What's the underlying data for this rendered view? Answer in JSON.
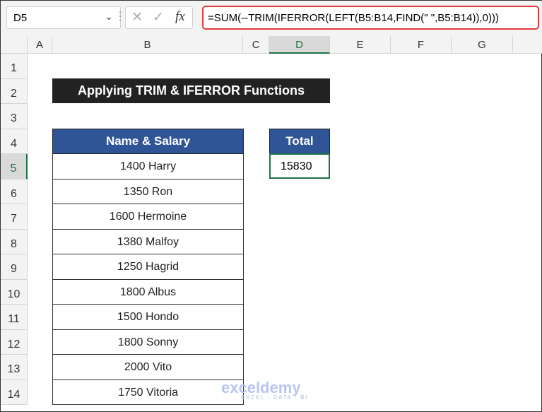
{
  "name_box": "D5",
  "formula": "=SUM(--TRIM(IFERROR(LEFT(B5:B14,FIND(\" \",B5:B14)),0)))",
  "formula_icons": [
    "cancel-icon",
    "enter-icon",
    "fx-icon"
  ],
  "columns": [
    "A",
    "B",
    "C",
    "D",
    "E",
    "F",
    "G"
  ],
  "rows": [
    "1",
    "2",
    "3",
    "4",
    "5",
    "6",
    "7",
    "8",
    "9",
    "10",
    "11",
    "12",
    "13",
    "14"
  ],
  "selected_cell": "D5",
  "title": "Applying TRIM & IFERROR Functions",
  "table": {
    "header": "Name & Salary",
    "values": [
      "1400 Harry",
      "1350 Ron",
      "1600 Hermoine",
      "1380 Malfoy",
      "1250 Hagrid",
      "1800 Albus",
      "1500 Hondo",
      "1800 Sonny",
      "2000 Vito",
      "1750 Vitoria"
    ]
  },
  "total": {
    "header": "Total",
    "value": "15830"
  },
  "watermark": {
    "name": "exceldemy",
    "tagline": "EXCEL · DATA · BI"
  },
  "colors": {
    "header_fill": "#2f5597",
    "title_fill": "#222222",
    "selection": "#217346",
    "formula_border": "#e03c3c"
  }
}
